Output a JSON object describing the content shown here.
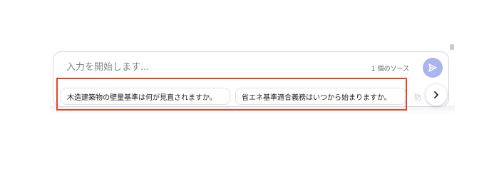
{
  "composer": {
    "placeholder": "入力を開始します...",
    "source_count": "1 個のソース",
    "send_icon": "send-icon"
  },
  "suggestions": {
    "chips": [
      "木造建築物の壁量基準は何が見直されますか。",
      "省エネ基準適合義務はいつから始まりますか。"
    ],
    "partial_chip": "防",
    "next_icon": "chevron-right-icon"
  },
  "colors": {
    "send_button": "#aab4f0",
    "highlight_border": "#e8431f",
    "chip_border": "#e0e2e6"
  }
}
